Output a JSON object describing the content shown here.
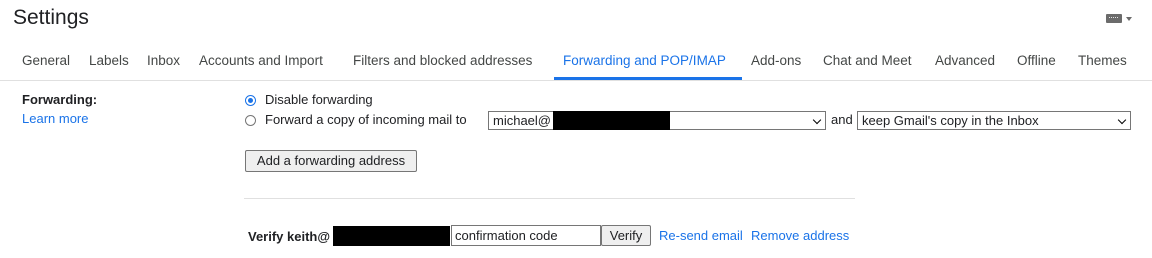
{
  "header": {
    "title": "Settings",
    "keyboard_icon": "keyboard-icon"
  },
  "tabs": [
    {
      "label": "General"
    },
    {
      "label": "Labels"
    },
    {
      "label": "Inbox"
    },
    {
      "label": "Accounts and Import"
    },
    {
      "label": "Filters and blocked addresses"
    },
    {
      "label": "Forwarding and POP/IMAP",
      "active": true
    },
    {
      "label": "Add-ons"
    },
    {
      "label": "Chat and Meet"
    },
    {
      "label": "Advanced"
    },
    {
      "label": "Offline"
    },
    {
      "label": "Themes"
    }
  ],
  "forwarding": {
    "section_label": "Forwarding:",
    "learn_more": "Learn more",
    "disable_option": "Disable forwarding",
    "forward_option": "Forward a copy of incoming mail to",
    "forward_address": "michael@",
    "and_text": "and",
    "keep_option": "keep Gmail's copy in the Inbox",
    "add_button": "Add a forwarding address",
    "verify_label": "Verify keith@",
    "confirmation_placeholder": "confirmation code",
    "verify_button": "Verify",
    "resend_link": "Re-send email",
    "remove_link": "Remove address"
  },
  "colors": {
    "accent": "#1a73e8",
    "text": "#202124"
  }
}
